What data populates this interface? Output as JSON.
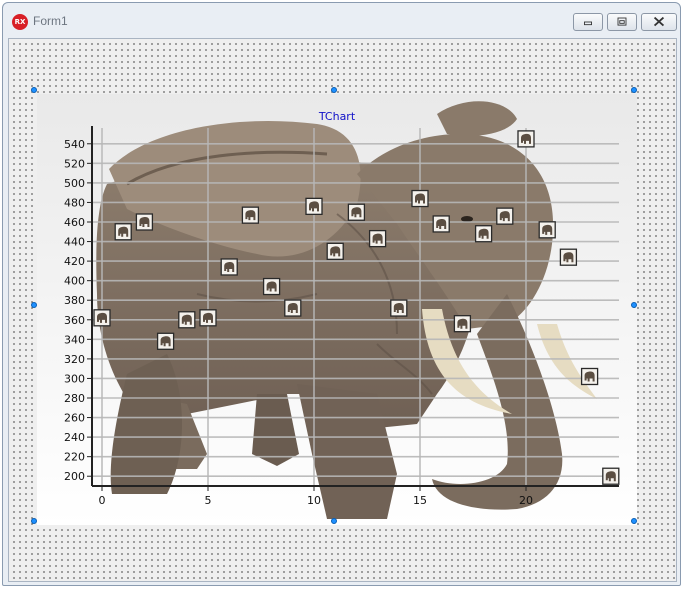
{
  "window": {
    "title": "Form1",
    "icon_label": "RX",
    "accent": "#d81f26"
  },
  "buttons": {
    "minimize": "minimize-icon",
    "maximize": "maximize-icon",
    "close": "close-icon"
  },
  "chart_data": {
    "type": "scatter",
    "title": "TChart",
    "title_color": "#1010c8",
    "xlim": [
      -0.5,
      24.5
    ],
    "ylim": [
      190,
      550
    ],
    "x_ticks": [
      0,
      5,
      10,
      15,
      20
    ],
    "y_ticks": [
      200,
      220,
      240,
      260,
      280,
      300,
      320,
      340,
      360,
      380,
      400,
      420,
      440,
      460,
      480,
      500,
      520,
      540
    ],
    "grid": true,
    "marker_icon": "elephant-icon",
    "background_image": "elephant-picture",
    "series": [
      {
        "x": [
          0,
          1,
          2,
          3,
          4,
          5,
          6,
          7,
          8,
          9,
          10,
          11,
          12,
          13,
          14,
          15,
          16,
          17,
          18,
          19,
          20,
          21,
          22,
          23,
          24
        ],
        "y": [
          362,
          450,
          460,
          338,
          360,
          362,
          414,
          467,
          394,
          372,
          476,
          430,
          470,
          443,
          372,
          484,
          458,
          356,
          448,
          466,
          545,
          452,
          424,
          302,
          200
        ]
      }
    ]
  }
}
